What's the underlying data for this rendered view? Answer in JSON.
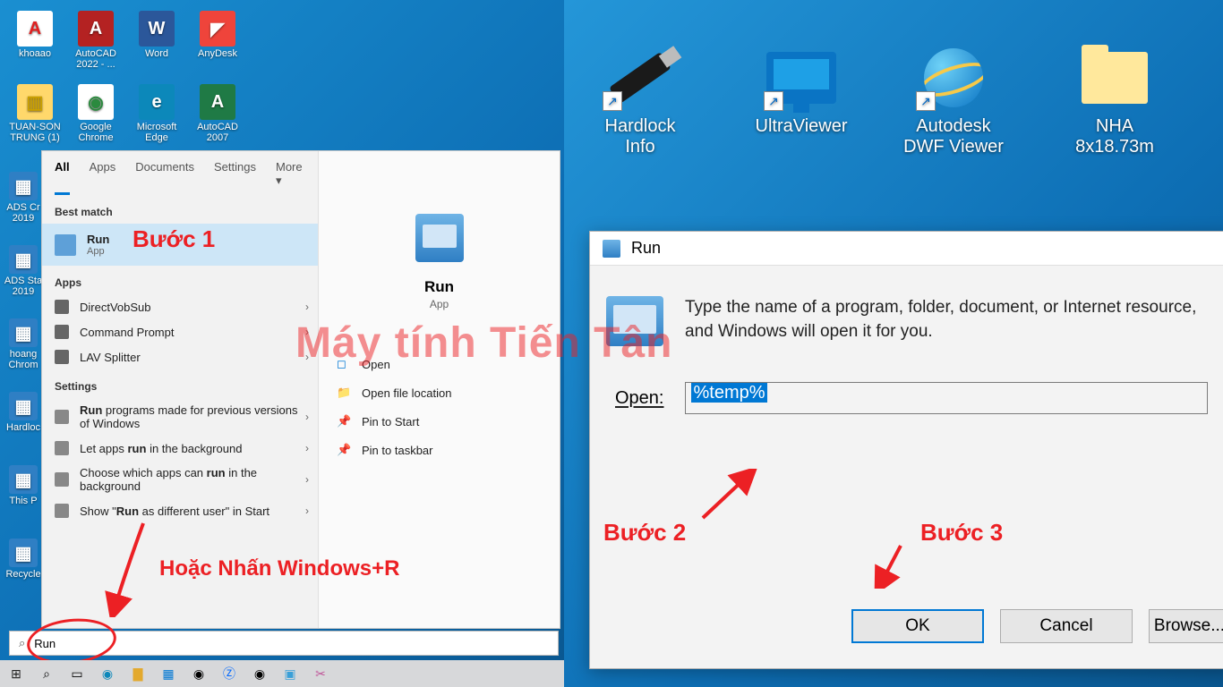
{
  "left_icons": [
    {
      "label": "khoaao",
      "color": "#fff",
      "fg": "#e02020",
      "glyph": "A"
    },
    {
      "label": "AutoCAD 2022 - ...",
      "color": "#b42222",
      "fg": "#fff",
      "glyph": "A"
    },
    {
      "label": "Word",
      "color": "#2b579a",
      "fg": "#fff",
      "glyph": "W"
    },
    {
      "label": "AnyDesk",
      "color": "#ef443b",
      "fg": "#fff",
      "glyph": "◤"
    },
    {
      "label": "TUAN-SON TRUNG (1)",
      "color": "#ffd86b",
      "fg": "#caa000",
      "glyph": "▥"
    },
    {
      "label": "Google Chrome",
      "color": "#fff",
      "fg": "#2b8a3e",
      "glyph": "◉"
    },
    {
      "label": "Microsoft Edge",
      "color": "#0c88ba",
      "fg": "#fff",
      "glyph": "e"
    },
    {
      "label": "AutoCAD 2007",
      "color": "#1f7a45",
      "fg": "#fff",
      "glyph": "A"
    }
  ],
  "left_strip": [
    {
      "label": "ADS Cr 2019"
    },
    {
      "label": "ADS Sta 2019"
    },
    {
      "label": "hoang Chrom"
    },
    {
      "label": "Hardloc"
    },
    {
      "label": "This P"
    },
    {
      "label": "Recycle"
    }
  ],
  "start_menu": {
    "tabs": [
      "All",
      "Apps",
      "Documents",
      "Settings",
      "More ▾"
    ],
    "best_match_h": "Best match",
    "best_match": {
      "title": "Run",
      "sub": "App"
    },
    "apps_h": "Apps",
    "apps": [
      "DirectVobSub",
      "Command Prompt",
      "LAV Splitter"
    ],
    "settings_h": "Settings",
    "settings": [
      "Run programs made for previous versions of Windows",
      "Let apps run in the background",
      "Choose which apps can run in the background",
      "Show \"Run as different user\" in Start"
    ],
    "preview": {
      "title": "Run",
      "sub": "App"
    },
    "actions": [
      "Open",
      "Open file location",
      "Pin to Start",
      "Pin to taskbar"
    ]
  },
  "search_value": "Run",
  "right_icons": [
    {
      "label": "Hardlock Info",
      "type": "usb"
    },
    {
      "label": "UltraViewer",
      "type": "monitor"
    },
    {
      "label": "Autodesk DWF Viewer",
      "type": "globe"
    },
    {
      "label": "NHA 8x18.73m",
      "type": "folder"
    }
  ],
  "run_dialog": {
    "title": "Run",
    "desc": "Type the name of a program, folder, document, or Internet resource, and Windows will open it for you.",
    "open_label": "Open:",
    "input_value": "%temp%",
    "buttons": [
      "OK",
      "Cancel",
      "Browse..."
    ]
  },
  "annotations": {
    "step1": "Bước 1",
    "step2": "Bước 2",
    "step3": "Bước 3",
    "alt": "Hoặc Nhấn Windows+R",
    "watermark": "Máy tính Tiến Tân"
  }
}
